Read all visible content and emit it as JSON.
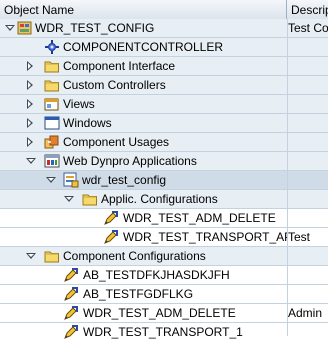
{
  "header": {
    "col_object": "Object Name",
    "col_desc": "Descrip"
  },
  "tree": {
    "root": {
      "label": "WDR_TEST_CONFIG",
      "desc": "Test Co"
    },
    "componentcontroller": {
      "label": "COMPONENTCONTROLLER"
    },
    "component_interface": {
      "label": "Component Interface"
    },
    "custom_controllers": {
      "label": "Custom Controllers"
    },
    "views": {
      "label": "Views"
    },
    "windows": {
      "label": "Windows"
    },
    "component_usages": {
      "label": "Component Usages"
    },
    "web_dynpro_apps": {
      "label": "Web Dynpro Applications"
    },
    "wdr_test_config_app": {
      "label": "wdr_test_config"
    },
    "applic_configs": {
      "label": "Applic. Configurations"
    },
    "adm_delete_app": {
      "label": "WDR_TEST_ADM_DELETE"
    },
    "transport_app": {
      "label": "WDR_TEST_TRANSPORT_AP",
      "desc": "Test"
    },
    "component_configs": {
      "label": "Component Configurations"
    },
    "ab_testdfk": {
      "label": "AB_TESTDFKJHASDKJFH"
    },
    "ab_testfgd": {
      "label": "AB_TESTFGDFLKG"
    },
    "adm_delete_cfg": {
      "label": "WDR_TEST_ADM_DELETE",
      "desc": "Admin"
    },
    "transport_cfg": {
      "label": "WDR_TEST_TRANSPORT_1"
    }
  }
}
